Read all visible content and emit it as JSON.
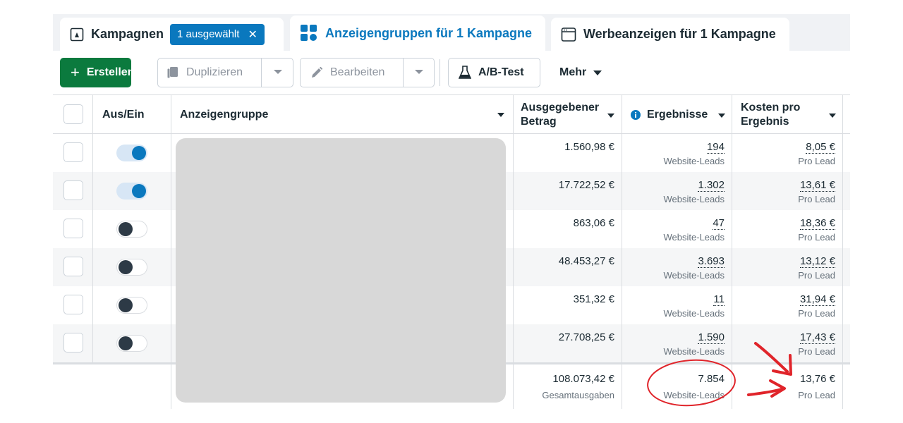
{
  "tabs": {
    "campaigns": {
      "label": "Kampagnen",
      "badge": "1 ausgewählt",
      "badge_close": "✕"
    },
    "adsets": {
      "label": "Anzeigengruppen für 1 Kampagne"
    },
    "ads": {
      "label": "Werbeanzeigen für 1 Kampagne"
    }
  },
  "toolbar": {
    "create_label": "Erstellen",
    "duplicate_label": "Duplizieren",
    "edit_label": "Bearbeiten",
    "ab_test_label": "A/B-Test",
    "more_label": "Mehr"
  },
  "table": {
    "headers": {
      "on_off": "Aus/Ein",
      "adset": "Anzeigengruppe",
      "spent_line1": "Ausgegebener",
      "spent_line2": "Betrag",
      "results": "Ergebnisse",
      "cost_line1": "Kosten pro",
      "cost_line2": "Ergebnis"
    },
    "rows": [
      {
        "on": true,
        "spent": "1.560,98 €",
        "results": "194",
        "results_type": "Website-Leads",
        "cost": "8,05 €",
        "cost_type": "Pro Lead"
      },
      {
        "on": true,
        "spent": "17.722,52 €",
        "results": "1.302",
        "results_type": "Website-Leads",
        "cost": "13,61 €",
        "cost_type": "Pro Lead"
      },
      {
        "on": false,
        "spent": "863,06 €",
        "results": "47",
        "results_type": "Website-Leads",
        "cost": "18,36 €",
        "cost_type": "Pro Lead"
      },
      {
        "on": false,
        "spent": "48.453,27 €",
        "results": "3.693",
        "results_type": "Website-Leads",
        "cost": "13,12 €",
        "cost_type": "Pro Lead"
      },
      {
        "on": false,
        "spent": "351,32 €",
        "results": "11",
        "results_type": "Website-Leads",
        "cost": "31,94 €",
        "cost_type": "Pro Lead"
      },
      {
        "on": false,
        "spent": "27.708,25 €",
        "results": "1.590",
        "results_type": "Website-Leads",
        "cost": "17,43 €",
        "cost_type": "Pro Lead"
      }
    ],
    "totals": {
      "spent": "108.073,42 €",
      "spent_label": "Gesamtausgaben",
      "results": "7.854",
      "results_label": "Website-Leads",
      "cost": "13,76 €",
      "cost_label": "Pro Lead"
    }
  },
  "colors": {
    "accent": "#0a78be",
    "create_button": "#0b7a3e",
    "annotation": "#e0242a"
  },
  "icons": {
    "campaigns": "campaign-flag-icon",
    "adsets": "grid-icon",
    "ads": "ad-window-icon",
    "duplicate": "duplicate-icon",
    "edit": "pencil-icon",
    "ab_test": "flask-icon",
    "info": "info-icon"
  }
}
